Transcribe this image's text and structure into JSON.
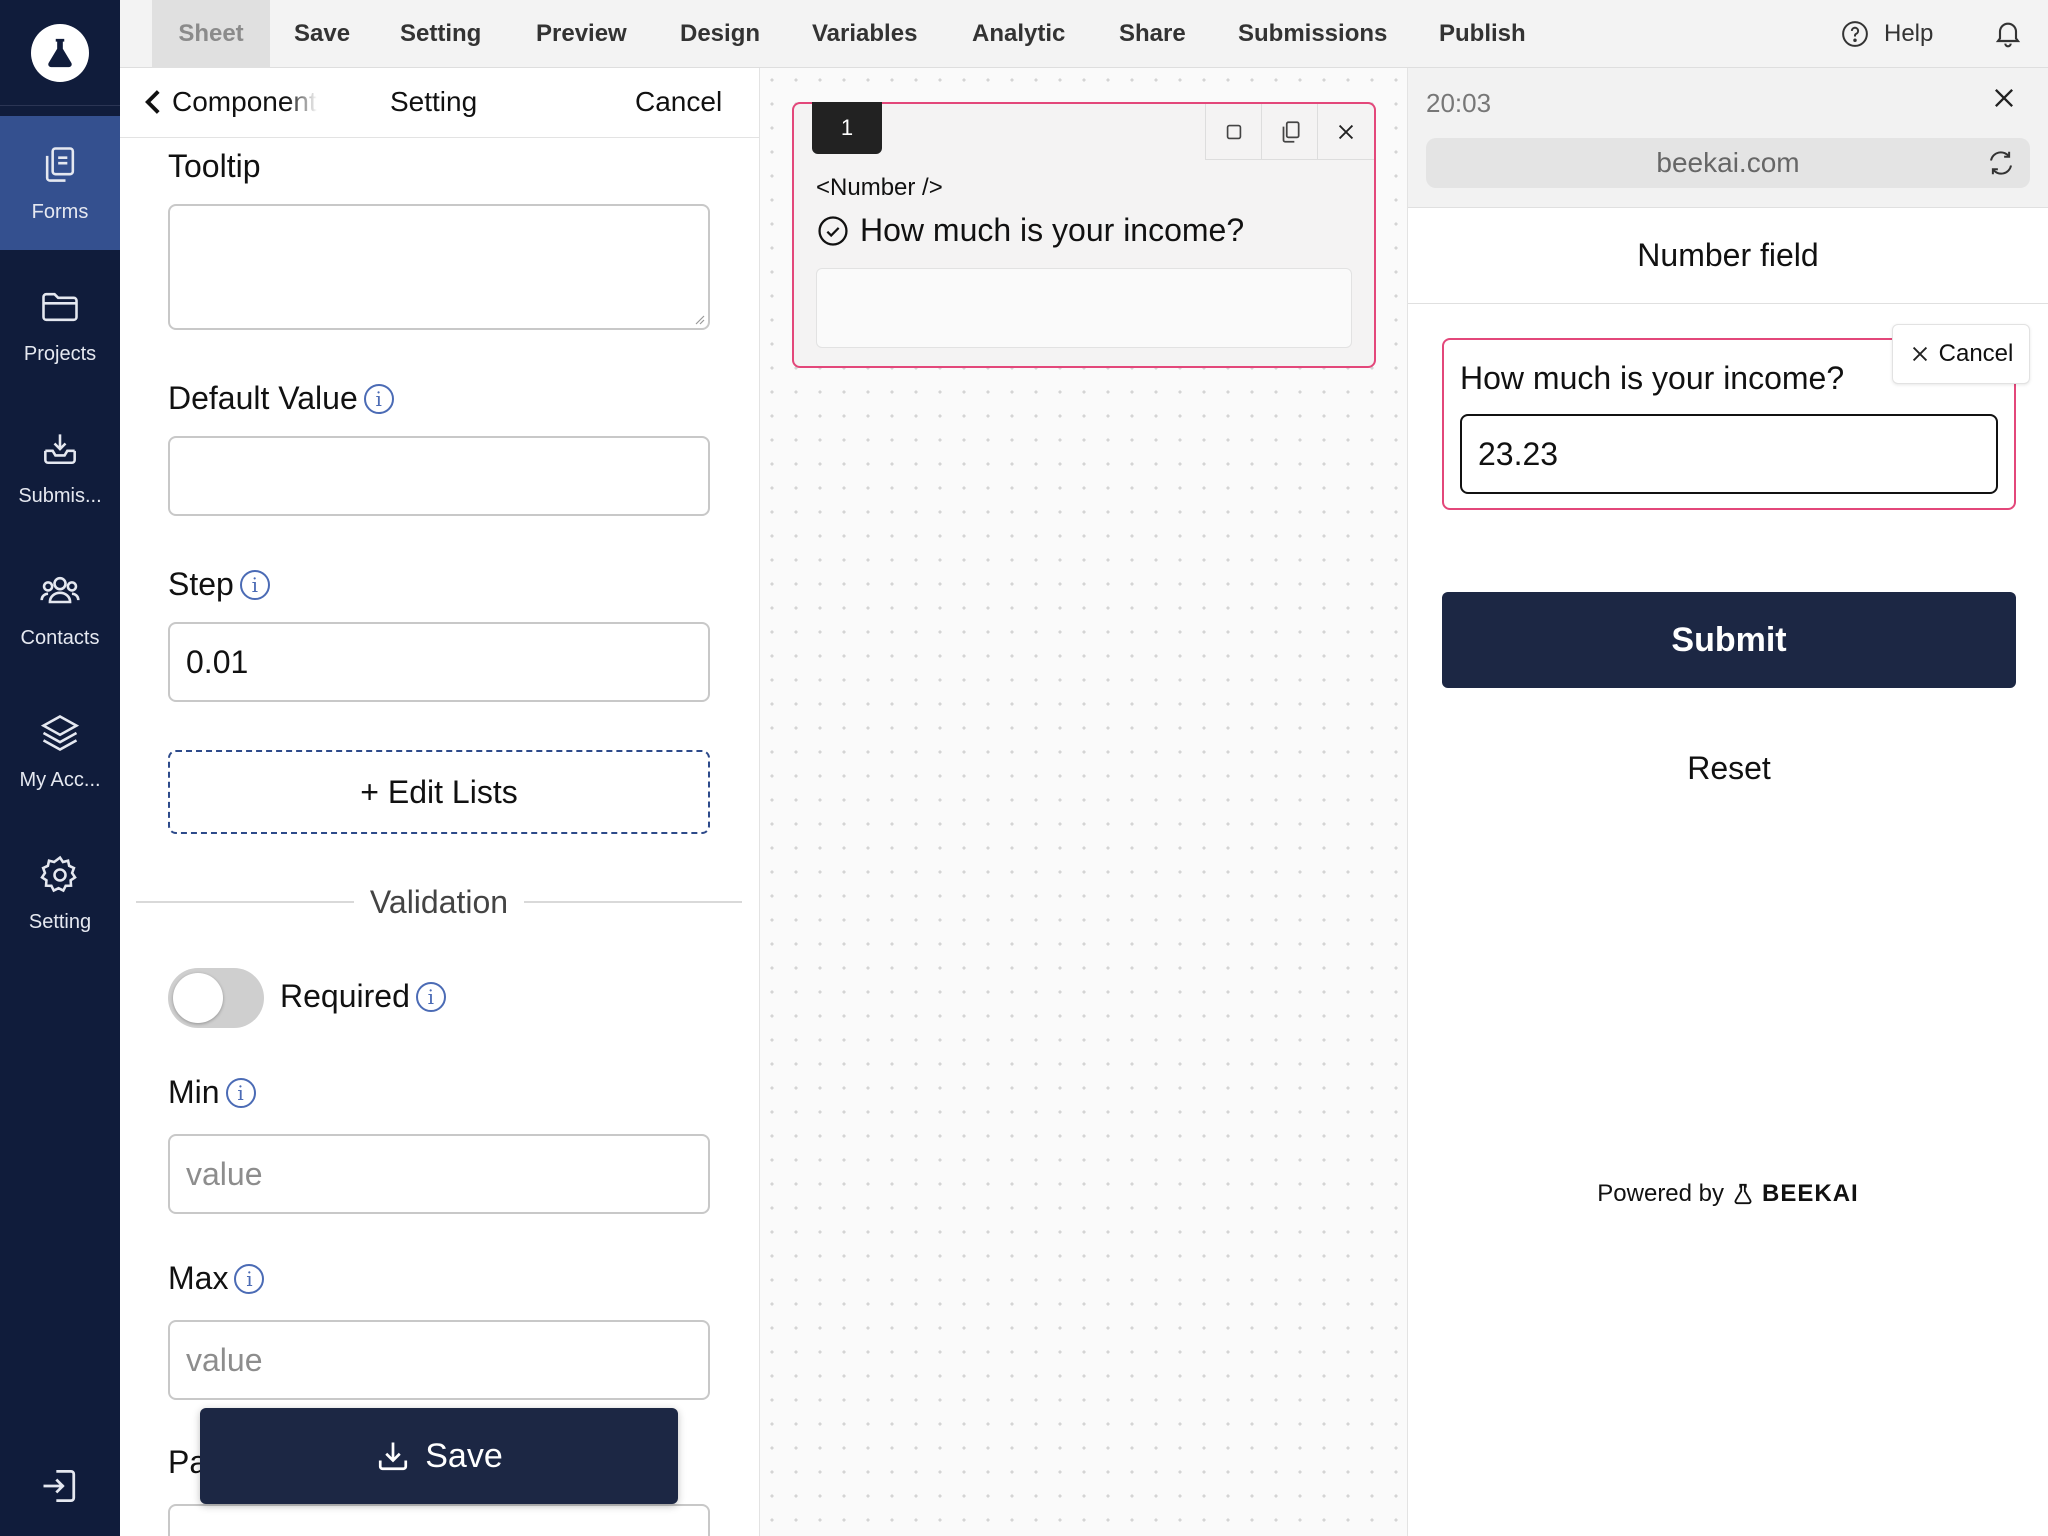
{
  "sidebar": {
    "logo_icon": "flask-icon",
    "items": [
      {
        "label": "Forms",
        "icon": "forms-icon",
        "active": true
      },
      {
        "label": "Projects",
        "icon": "folder-icon"
      },
      {
        "label": "Submis...",
        "icon": "inbox-icon"
      },
      {
        "label": "Contacts",
        "icon": "contacts-icon"
      },
      {
        "label": "My Acc...",
        "icon": "layers-icon"
      },
      {
        "label": "Setting",
        "icon": "gear-icon"
      }
    ],
    "logout_icon": "logout-icon"
  },
  "topbar": {
    "menu": [
      "Sheet",
      "Save",
      "Setting",
      "Preview",
      "Design",
      "Variables",
      "Analytic",
      "Share",
      "Submissions",
      "Publish"
    ],
    "active": "Sheet",
    "help": "Help"
  },
  "settings": {
    "back_label": "Component",
    "title": "Setting",
    "cancel": "Cancel",
    "tooltip_label": "Tooltip",
    "default_value_label": "Default Value",
    "step_label": "Step",
    "step_value": "0.01",
    "edit_lists": "+ Edit Lists",
    "validation": "Validation",
    "required_label": "Required",
    "required_on": false,
    "min_label": "Min",
    "min_placeholder": "value",
    "max_label": "Max",
    "max_placeholder": "value",
    "next_label_partial": "Pa",
    "save": "Save"
  },
  "canvas": {
    "card_number": "1",
    "tag": "<Number />",
    "question": "How much is your income?"
  },
  "preview": {
    "time": "20:03",
    "url": "beekai.com",
    "title": "Number field",
    "question": "How much is your income?",
    "input_value": "23.23",
    "cancel": "Cancel",
    "submit": "Submit",
    "reset": "Reset",
    "powered_by": "Powered by",
    "brand": "BEEKAI"
  },
  "colors": {
    "nav_bg": "#101c3b",
    "nav_active": "#34508f",
    "accent_pink": "#e3477a",
    "button_dark": "#1c2744"
  }
}
